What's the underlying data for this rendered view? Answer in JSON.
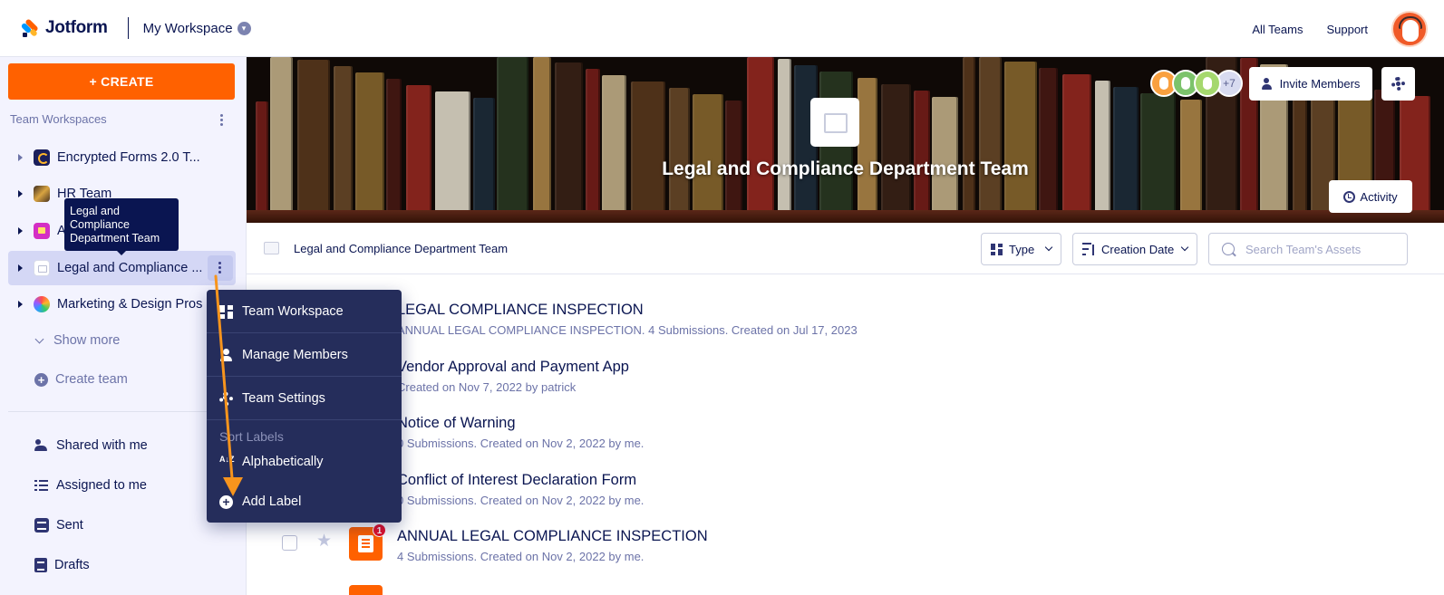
{
  "app": {
    "brand": "Jotform",
    "workspace_title": "My Workspace",
    "links": [
      "All Teams",
      "Support"
    ]
  },
  "sidebar": {
    "create_label": "+ CREATE",
    "section_title": "Team Workspaces",
    "teams": [
      {
        "label": "Encrypted Forms 2.0 T...",
        "icon": "encrypted-forms-team-icon"
      },
      {
        "label": "HR Team",
        "icon": "hr-team-icon"
      },
      {
        "label": "A...Pl...",
        "icon": "pink-team-icon"
      },
      {
        "label": "Legal and Compliance ...",
        "icon": "legal-team-icon",
        "active": true
      },
      {
        "label": "Marketing & Design Pros",
        "icon": "marketing-team-icon"
      }
    ],
    "show_more": "Show more",
    "create_team": "Create team",
    "nav": [
      {
        "label": "Shared with me",
        "icon": "people-icon"
      },
      {
        "label": "Assigned to me",
        "icon": "checklist-icon"
      },
      {
        "label": "Sent",
        "icon": "sent-icon"
      },
      {
        "label": "Drafts",
        "icon": "drafts-icon"
      }
    ]
  },
  "tooltip": {
    "lines": [
      "Legal and",
      "Compliance",
      "Department Team"
    ]
  },
  "banner": {
    "team_title": "Legal and Compliance Department Team",
    "more_members": "+7",
    "invite_label": "Invite Members",
    "activity_label": "Activity"
  },
  "toolbar": {
    "breadcrumb": "Legal and Compliance Department Team",
    "type_label": "Type",
    "sort_label": "Creation Date",
    "search_placeholder": "Search Team's Assets"
  },
  "assets": [
    {
      "title": "LEGAL COMPLIANCE INSPECTION",
      "meta": "ANNUAL LEGAL COMPLIANCE INSPECTION. 4 Submissions. Created on Jul 17, 2023"
    },
    {
      "title": "Vendor Approval and Payment App",
      "meta": "Created on Nov 7, 2022 by patrick"
    },
    {
      "title": "Notice of Warning",
      "meta": "0 Submissions. Created on Nov 2, 2022 by me."
    },
    {
      "title": "Conflict of Interest Declaration Form",
      "meta": "0 Submissions. Created on Nov 2, 2022 by me."
    },
    {
      "title": "ANNUAL LEGAL COMPLIANCE INSPECTION",
      "meta": "4 Submissions. Created on Nov 2, 2022 by me.",
      "badge": "1"
    }
  ],
  "context_menu": {
    "items": [
      "Team Workspace",
      "Manage Members",
      "Team Settings"
    ],
    "sort_heading": "Sort Labels",
    "sort_option": "Alphabetically",
    "add_label": "Add Label",
    "alpha_glyph": "A↓Z"
  },
  "colors": {
    "brand_orange": "#ff6100",
    "navy": "#0a1551",
    "menu_bg": "#252d5b",
    "annotation_arrow": "#f7941d"
  }
}
